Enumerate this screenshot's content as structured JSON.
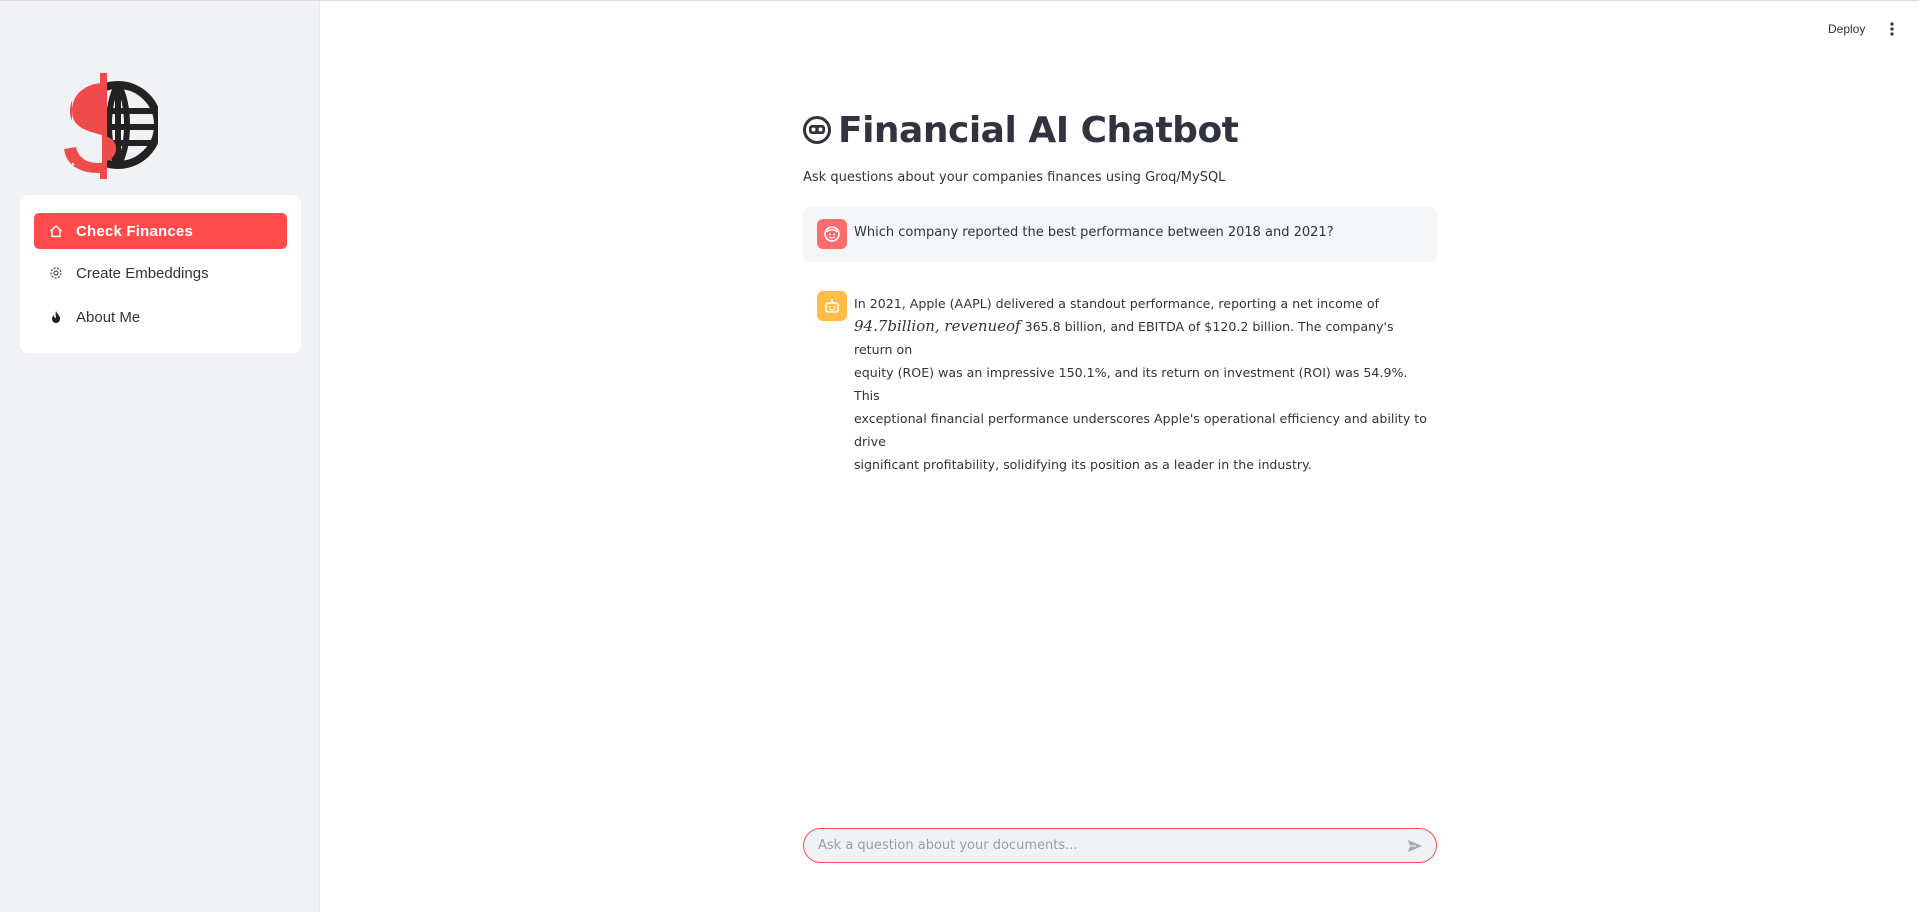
{
  "header": {
    "deploy_label": "Deploy",
    "menu_icon": "vertical-dots-icon"
  },
  "sidebar": {
    "logo_icon": "dollar-globe-logo",
    "items": [
      {
        "label": "Check Finances",
        "icon": "house-icon",
        "active": true
      },
      {
        "label": "Create Embeddings",
        "icon": "gear-icon",
        "active": false
      },
      {
        "label": "About Me",
        "icon": "flame-icon",
        "active": false
      }
    ]
  },
  "main": {
    "title_icon": "robot-face-icon",
    "title": "Financial AI Chatbot",
    "subtitle": "Ask questions about your companies finances using Groq/MySQL",
    "messages": [
      {
        "role": "user",
        "avatar_icon": "user-face-icon",
        "text": "Which company reported the best performance between 2018 and 2021?"
      },
      {
        "role": "assistant",
        "avatar_icon": "robot-icon",
        "line1": "In 2021, Apple (AAPL) delivered a standout performance, reporting a net income of",
        "math_span": "94.7billion, revenueof",
        "line2_rest": "365.8 billion, and EBITDA of $120.2 billion. The company's return on",
        "line3": "equity (ROE) was an impressive 150.1%, and its return on investment (ROI) was 54.9%. This",
        "line4": "exceptional financial performance underscores Apple's operational efficiency and ability to drive",
        "line5": "significant profitability, solidifying its position as a leader in the industry."
      }
    ]
  },
  "chat_input": {
    "placeholder": "Ask a question about your documents...",
    "value": "",
    "send_icon": "send-arrow-icon"
  },
  "colors": {
    "accent": "#ff4b4b",
    "sidebar_bg": "#f0f2f6",
    "user_avatar": "#ff6c6c",
    "bot_avatar": "#ffbd45",
    "text": "#31333f"
  }
}
